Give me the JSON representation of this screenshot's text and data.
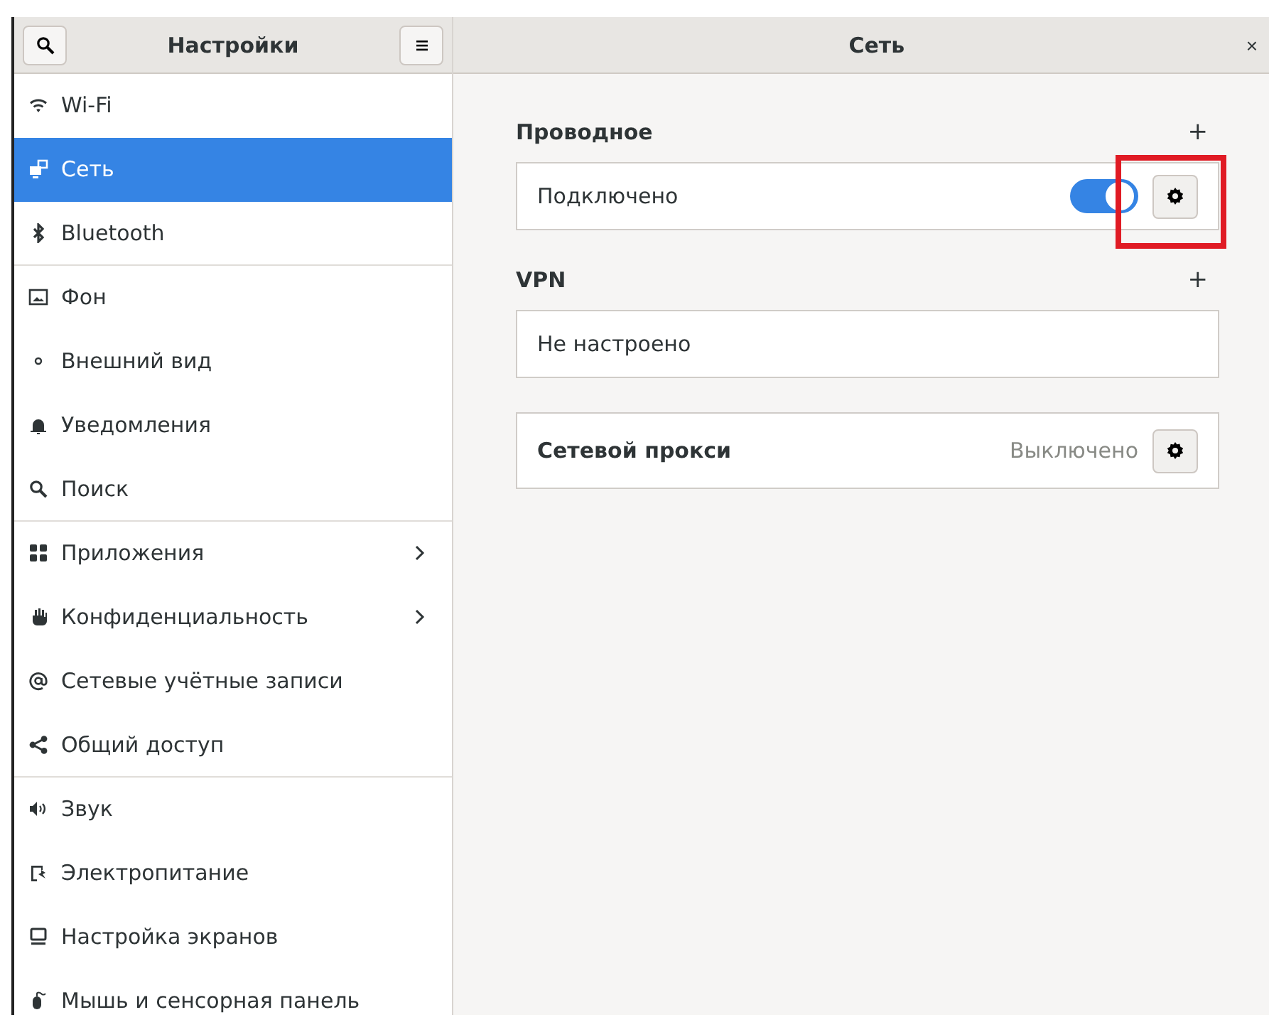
{
  "sidebar": {
    "title": "Настройки",
    "groups": [
      {
        "items": [
          {
            "label": "Wi-Fi",
            "selected": false,
            "has_arrow": false
          },
          {
            "label": "Сеть",
            "selected": true,
            "has_arrow": false
          },
          {
            "label": "Bluetooth",
            "selected": false,
            "has_arrow": false
          }
        ]
      },
      {
        "items": [
          {
            "label": "Фон",
            "selected": false,
            "has_arrow": false
          },
          {
            "label": "Внешний вид",
            "selected": false,
            "has_arrow": false
          },
          {
            "label": "Уведомления",
            "selected": false,
            "has_arrow": false
          },
          {
            "label": "Поиск",
            "selected": false,
            "has_arrow": false
          }
        ]
      },
      {
        "items": [
          {
            "label": "Приложения",
            "selected": false,
            "has_arrow": true
          },
          {
            "label": "Конфиденциальность",
            "selected": false,
            "has_arrow": true
          },
          {
            "label": "Сетевые учётные записи",
            "selected": false,
            "has_arrow": false
          },
          {
            "label": "Общий доступ",
            "selected": false,
            "has_arrow": false
          }
        ]
      },
      {
        "items": [
          {
            "label": "Звук",
            "selected": false,
            "has_arrow": false
          },
          {
            "label": "Электропитание",
            "selected": false,
            "has_arrow": false
          },
          {
            "label": "Настройка экранов",
            "selected": false,
            "has_arrow": false
          },
          {
            "label": "Мышь и сенсорная панель",
            "selected": false,
            "has_arrow": false
          }
        ]
      }
    ]
  },
  "main": {
    "title": "Сеть",
    "close": "×",
    "sections": [
      {
        "kind": "group",
        "title": "Проводное",
        "add": "+",
        "rows": [
          {
            "label": "Подключено",
            "on": true,
            "highlighted": true
          }
        ]
      },
      {
        "kind": "group",
        "title": "VPN",
        "add": "+",
        "rows": [
          {
            "label": "Не настроено"
          }
        ]
      },
      {
        "kind": "proxy",
        "label": "Сетевой прокси",
        "status": "Выключено"
      }
    ]
  }
}
